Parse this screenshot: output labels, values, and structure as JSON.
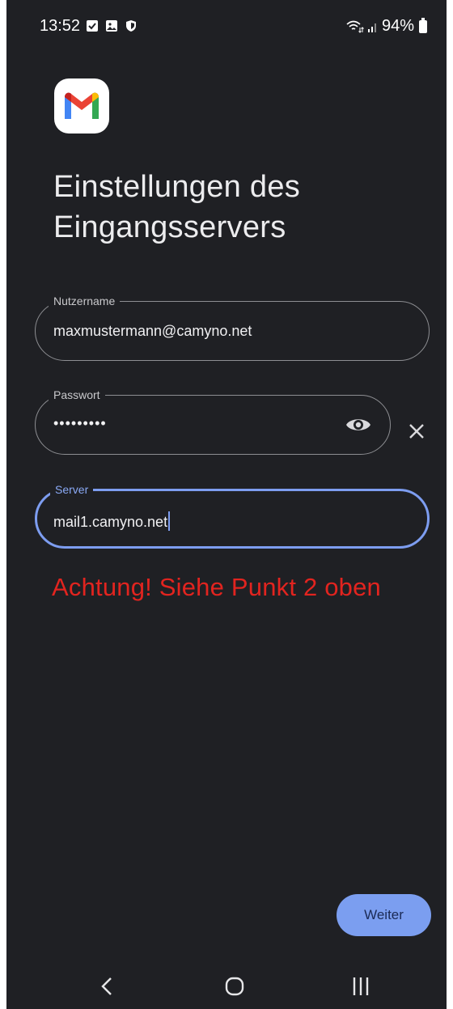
{
  "status_bar": {
    "time": "13:52",
    "battery": "94%",
    "left_icons": [
      "checkbox-icon",
      "image-icon",
      "shield-icon"
    ],
    "right_icons": [
      "wifi-icon",
      "signal-icon",
      "battery-icon"
    ]
  },
  "app": {
    "logo": "gmail-logo"
  },
  "page": {
    "title_line1": "Einstellungen des",
    "title_line2": "Eingangsservers"
  },
  "form": {
    "username": {
      "label": "Nutzername",
      "value": "maxmustermann@camyno.net"
    },
    "password": {
      "label": "Passwort",
      "value": "•••••••••"
    },
    "server": {
      "label": "Server",
      "value": "mail1.camyno.net"
    }
  },
  "annotation": {
    "warning": "Achtung! Siehe Punkt 2 oben"
  },
  "actions": {
    "next_label": "Weiter"
  },
  "nav_bar": {
    "icons": [
      "back-icon",
      "home-icon",
      "recents-icon"
    ]
  },
  "colors": {
    "background": "#1f2024",
    "accent": "#7b9ef0",
    "warning": "#e2241f",
    "outline": "#8d8e92"
  }
}
